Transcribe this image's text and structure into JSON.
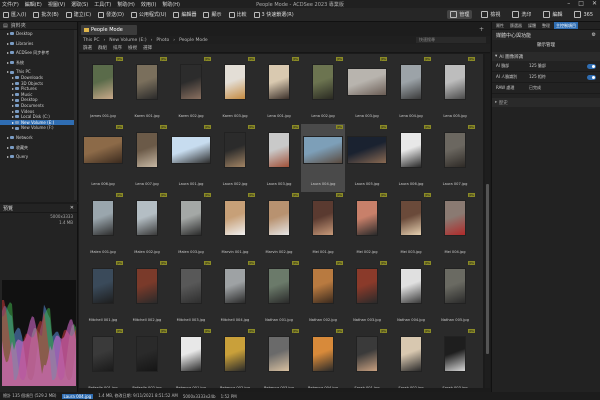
{
  "window": {
    "title": "People Mode - ACDSee 2023 專業版",
    "menu": [
      "文件(F)",
      "編輯(E)",
      "視圖(V)",
      "選取(S)",
      "工具(T)",
      "幫助(H)",
      "效用(I)",
      "幫助(H)"
    ]
  },
  "toolbar": {
    "items": [
      "匯入(I)",
      "批次(B)",
      "建立(C)",
      "發送(D)",
      "公用程式(U)",
      "編輯器",
      "顯示",
      "比較",
      "3 快速鎖選(R)"
    ],
    "modes": [
      {
        "label": "管理",
        "active": true
      },
      {
        "label": "檢視",
        "active": false
      },
      {
        "label": "洗印",
        "active": false
      },
      {
        "label": "編輯",
        "active": false
      },
      {
        "label": "365",
        "active": false
      }
    ]
  },
  "folders": {
    "panel_title": "資料夾",
    "items": [
      {
        "label": "Desktop",
        "indent": 1,
        "selected": false
      },
      {
        "label": "",
        "indent": 0,
        "gap": true
      },
      {
        "label": "Libraries",
        "indent": 1,
        "selected": false
      },
      {
        "label": "",
        "indent": 0,
        "gap": true
      },
      {
        "label": "ACDSee 同步參考",
        "indent": 1,
        "selected": false
      },
      {
        "label": "",
        "indent": 0,
        "gap": true
      },
      {
        "label": "系統",
        "indent": 1,
        "selected": false
      },
      {
        "label": "",
        "indent": 0,
        "gap": true
      },
      {
        "label": "This PC",
        "indent": 1,
        "selected": false
      },
      {
        "label": "Downloads",
        "indent": 2,
        "selected": false
      },
      {
        "label": "3D Objects",
        "indent": 2,
        "selected": false
      },
      {
        "label": "Pictures",
        "indent": 2,
        "selected": false
      },
      {
        "label": "Music",
        "indent": 2,
        "selected": false
      },
      {
        "label": "Desktop",
        "indent": 2,
        "selected": false
      },
      {
        "label": "Documents",
        "indent": 2,
        "selected": false
      },
      {
        "label": "Videos",
        "indent": 2,
        "selected": false
      },
      {
        "label": "Local Disk (C:)",
        "indent": 2,
        "selected": false
      },
      {
        "label": "New Volume (E:)",
        "indent": 2,
        "selected": true
      },
      {
        "label": "New Volume (F:)",
        "indent": 2,
        "selected": false
      },
      {
        "label": "",
        "indent": 0,
        "gap": true
      },
      {
        "label": "Network",
        "indent": 1,
        "selected": false
      },
      {
        "label": "",
        "indent": 0,
        "gap": true
      },
      {
        "label": "收藏夾",
        "indent": 1,
        "selected": false
      },
      {
        "label": "",
        "indent": 0,
        "gap": true
      },
      {
        "label": "Query",
        "indent": 1,
        "selected": false
      }
    ]
  },
  "preview": {
    "title": "預覽",
    "size_text": "5000x3333",
    "zoom_text": "1.4 MB"
  },
  "content": {
    "tab_label": "People Mode",
    "breadcrumb": [
      "This PC",
      "New Volume (E:)",
      "Photo",
      "People Mode"
    ],
    "search_placeholder": "快速搜尋",
    "filters": [
      "篩選",
      "群組",
      "排序",
      "檢視",
      "選擇"
    ]
  },
  "thumbnails": [
    {
      "name": "James 001.jpg",
      "orient": "portrait",
      "c1": "#5a6b4a",
      "c2": "#c9a98a"
    },
    {
      "name": "Karen 001.jpg",
      "orient": "portrait",
      "c1": "#7a6f5c",
      "c2": "#2a2a2a"
    },
    {
      "name": "Karen 002.jpg",
      "orient": "portrait",
      "c1": "#2c2c2c",
      "c2": "#8a7060"
    },
    {
      "name": "Karen 003.jpg",
      "orient": "portrait",
      "c1": "#e3ded6",
      "c2": "#c48a40"
    },
    {
      "name": "Lena 001.jpg",
      "orient": "portrait",
      "c1": "#d9c9b0",
      "c2": "#3b302a"
    },
    {
      "name": "Lena 002.jpg",
      "orient": "portrait",
      "c1": "#6c7450",
      "c2": "#2a2a22"
    },
    {
      "name": "Lena 003.jpg",
      "orient": "landscape",
      "c1": "#b8b4ae",
      "c2": "#6a5c54"
    },
    {
      "name": "Lena 004.jpg",
      "orient": "portrait",
      "c1": "#9ca3a8",
      "c2": "#3a3a3a"
    },
    {
      "name": "Lena 005.jpg",
      "orient": "portrait",
      "c1": "#bdbdbd",
      "c2": "#4a4a4a"
    },
    {
      "name": "Lena 006.jpg",
      "orient": "landscape",
      "c1": "#8c6a48",
      "c2": "#3a2a1e"
    },
    {
      "name": "Lena 007.jpg",
      "orient": "portrait",
      "c1": "#6b5a48",
      "c2": "#c7b8a4"
    },
    {
      "name": "Laura 001.jpg",
      "orient": "landscape",
      "c1": "#c7dcef",
      "c2": "#2c2c2c"
    },
    {
      "name": "Laura 002.jpg",
      "orient": "portrait",
      "c1": "#2b2b2b",
      "c2": "#a28464"
    },
    {
      "name": "Laura 003.jpg",
      "orient": "portrait",
      "c1": "#c9c9c9",
      "c2": "#a05038"
    },
    {
      "name": "Laura 004.jpg",
      "orient": "landscape",
      "c1": "#7d9fb8",
      "c2": "#5a4a3e",
      "selected": true
    },
    {
      "name": "Laura 005.jpg",
      "orient": "landscape",
      "c1": "#1a2230",
      "c2": "#8a6a52"
    },
    {
      "name": "Laura 006.jpg",
      "orient": "portrait",
      "c1": "#e8e8e8",
      "c2": "#2a2a2a"
    },
    {
      "name": "Laura 007.jpg",
      "orient": "portrait",
      "c1": "#6b6760",
      "c2": "#2e2a26"
    },
    {
      "name": "Malen 001.jpg",
      "orient": "portrait",
      "c1": "#9aa6ad",
      "c2": "#2e2e2e"
    },
    {
      "name": "Malen 002.jpg",
      "orient": "portrait",
      "c1": "#b4bec4",
      "c2": "#3a3a3a"
    },
    {
      "name": "Malen 003.jpg",
      "orient": "portrait",
      "c1": "#a4a8a6",
      "c2": "#2a2a2a"
    },
    {
      "name": "Marvin 001.jpg",
      "orient": "portrait",
      "c1": "#c7a078",
      "c2": "#f0f0f0"
    },
    {
      "name": "Marvin 002.jpg",
      "orient": "portrait",
      "c1": "#b89270",
      "c2": "#e6e6e6"
    },
    {
      "name": "Mei 001.jpg",
      "orient": "portrait",
      "c1": "#5a3a30",
      "c2": "#c89a7a"
    },
    {
      "name": "Mei 002.jpg",
      "orient": "portrait",
      "c1": "#c8806a",
      "c2": "#2a2a2a"
    },
    {
      "name": "Mei 003.jpg",
      "orient": "portrait",
      "c1": "#6a4a3a",
      "c2": "#e6d0b0"
    },
    {
      "name": "Mei 004.jpg",
      "orient": "portrait",
      "c1": "#8a7a72",
      "c2": "#b02a2a"
    },
    {
      "name": "Mitchell 001.jpg",
      "orient": "portrait",
      "c1": "#3a4a5a",
      "c2": "#1e1e1e"
    },
    {
      "name": "Mitchell 002.jpg",
      "orient": "portrait",
      "c1": "#7a3a2a",
      "c2": "#2a2a2a"
    },
    {
      "name": "Mitchell 003.jpg",
      "orient": "portrait",
      "c1": "#585858",
      "c2": "#2e2e2e"
    },
    {
      "name": "Mitchell 004.jpg",
      "orient": "portrait",
      "c1": "#9ea2a4",
      "c2": "#2a2a2a"
    },
    {
      "name": "Nathan 001.jpg",
      "orient": "portrait",
      "c1": "#6b7a6a",
      "c2": "#2a2a2a"
    },
    {
      "name": "Nathan 002.jpg",
      "orient": "portrait",
      "c1": "#b87a40",
      "c2": "#3a2a1e"
    },
    {
      "name": "Nathan 003.jpg",
      "orient": "portrait",
      "c1": "#8a3a2a",
      "c2": "#2a2a2a"
    },
    {
      "name": "Nathan 004.jpg",
      "orient": "portrait",
      "c1": "#e0e0e0",
      "c2": "#3a3a3a"
    },
    {
      "name": "Nathan 005.jpg",
      "orient": "portrait",
      "c1": "#6a6a62",
      "c2": "#2a2a2a"
    },
    {
      "name": "Rafaella 001.jpg",
      "orient": "portrait",
      "c1": "#3a3a3a",
      "c2": "#1a1a1a"
    },
    {
      "name": "Rafaella 002.jpg",
      "orient": "portrait",
      "c1": "#2a2a2a",
      "c2": "#151515"
    },
    {
      "name": "Rebecca 001.jpg",
      "orient": "portrait",
      "c1": "#e8e8e8",
      "c2": "#2a2a2a"
    },
    {
      "name": "Rebecca 002.jpg",
      "orient": "portrait",
      "c1": "#c9a03a",
      "c2": "#2a2a2a"
    },
    {
      "name": "Rebecca 003.jpg",
      "orient": "portrait",
      "c1": "#6a6a6a",
      "c2": "#d8c0a0"
    },
    {
      "name": "Rebecca 004.jpg",
      "orient": "portrait",
      "c1": "#d88a3a",
      "c2": "#2a2a2a"
    },
    {
      "name": "Sarah 001.jpg",
      "orient": "portrait",
      "c1": "#3a3a3a",
      "c2": "#c8a080"
    },
    {
      "name": "Sarah 002.jpg",
      "orient": "portrait",
      "c1": "#d8c8b0",
      "c2": "#2a2a2a"
    },
    {
      "name": "Sarah 003.jpg",
      "orient": "portrait",
      "c1": "#1e1e1e",
      "c2": "#d8d8d8"
    }
  ],
  "right_panel": {
    "tabs": [
      "屬性",
      "篩選器",
      "媒體",
      "整理",
      "主控制項目"
    ],
    "active_tab": 4,
    "header": "媒體中心與功能",
    "subheader": "顯示管理",
    "section1": "AI 圖像辨識",
    "rows": [
      {
        "label": "AI 臉部",
        "value": "125 臉部"
      },
      {
        "label": "AI 人臉識別",
        "value": "125 相符"
      },
      {
        "label": "RAW 處理",
        "value": "已完成"
      }
    ],
    "history_label": "歷史"
  },
  "status": {
    "total": "總計 135 個項目 (529.2 MB)",
    "selected_file": "Laura 004.jpg",
    "details": "1.4 MB, 修改日期: 9/11/2021 8:51:52 AM",
    "dims": "5000x3333x24b",
    "zoom": "1:52 PM"
  },
  "colors": {
    "accent": "#2f6db2",
    "jpg_badge": "#8a8a26",
    "histogram": [
      "#5a8fd8",
      "#3fae4a",
      "#c93a3a",
      "#e06fd8"
    ]
  }
}
